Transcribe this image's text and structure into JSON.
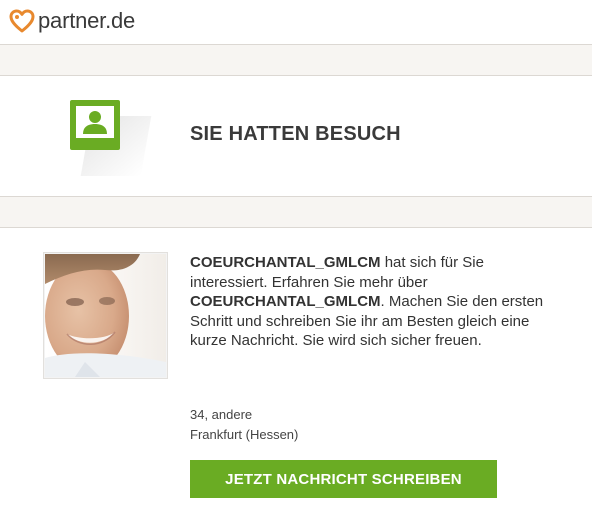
{
  "header": {
    "logo_text": "partner.de",
    "logo_icon": "heart-icon",
    "brand_color": "#e8892e"
  },
  "visit": {
    "title": "SIE HATTEN BESUCH",
    "icon": "profile-card-icon",
    "icon_color": "#6aac23"
  },
  "profile": {
    "photo": "profile-photo",
    "username": "COEURCHANTAL_GMLCM",
    "message_part1": " hat sich für Sie interessiert. Erfahren Sie mehr über ",
    "message_part2": ". Machen Sie den ersten Schritt und schreiben Sie ihr am Besten gleich eine kurze Nachricht. Sie wird sich sicher freuen.",
    "age_line": "34, andere",
    "location": "Frankfurt (Hessen)"
  },
  "cta": {
    "label": "JETZT NACHRICHT SCHREIBEN",
    "color": "#6aac23"
  }
}
